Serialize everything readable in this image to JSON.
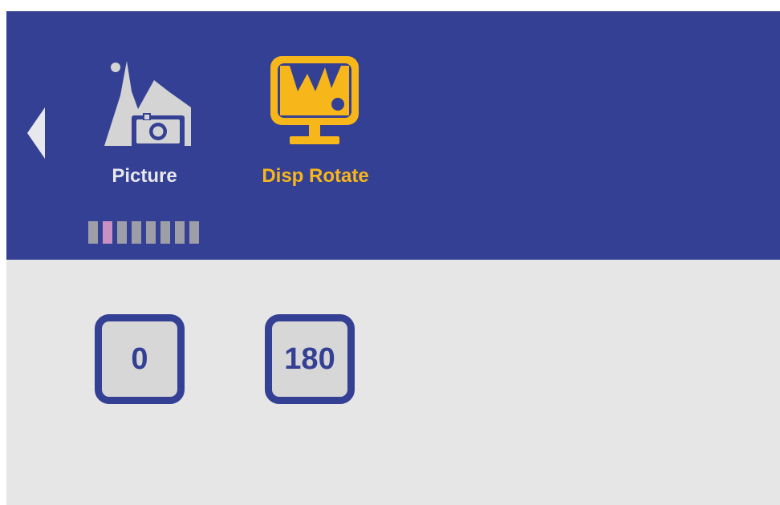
{
  "menu": {
    "items": [
      {
        "label": "Picture",
        "icon": "picture-icon",
        "active": false
      },
      {
        "label": "Disp Rotate",
        "icon": "display-rotate-icon",
        "active": true
      }
    ],
    "page_indicator": {
      "count": 8,
      "active_index": 1
    }
  },
  "rotation": {
    "options": [
      {
        "label": "0"
      },
      {
        "label": "180"
      }
    ]
  },
  "colors": {
    "header_bg": "#344093",
    "content_bg": "#e6e6e6",
    "accent": "#f7b61a",
    "inactive_icon": "#d4d4d4",
    "indicator_active": "#c990c4",
    "indicator_inactive": "#9e9ea8"
  }
}
